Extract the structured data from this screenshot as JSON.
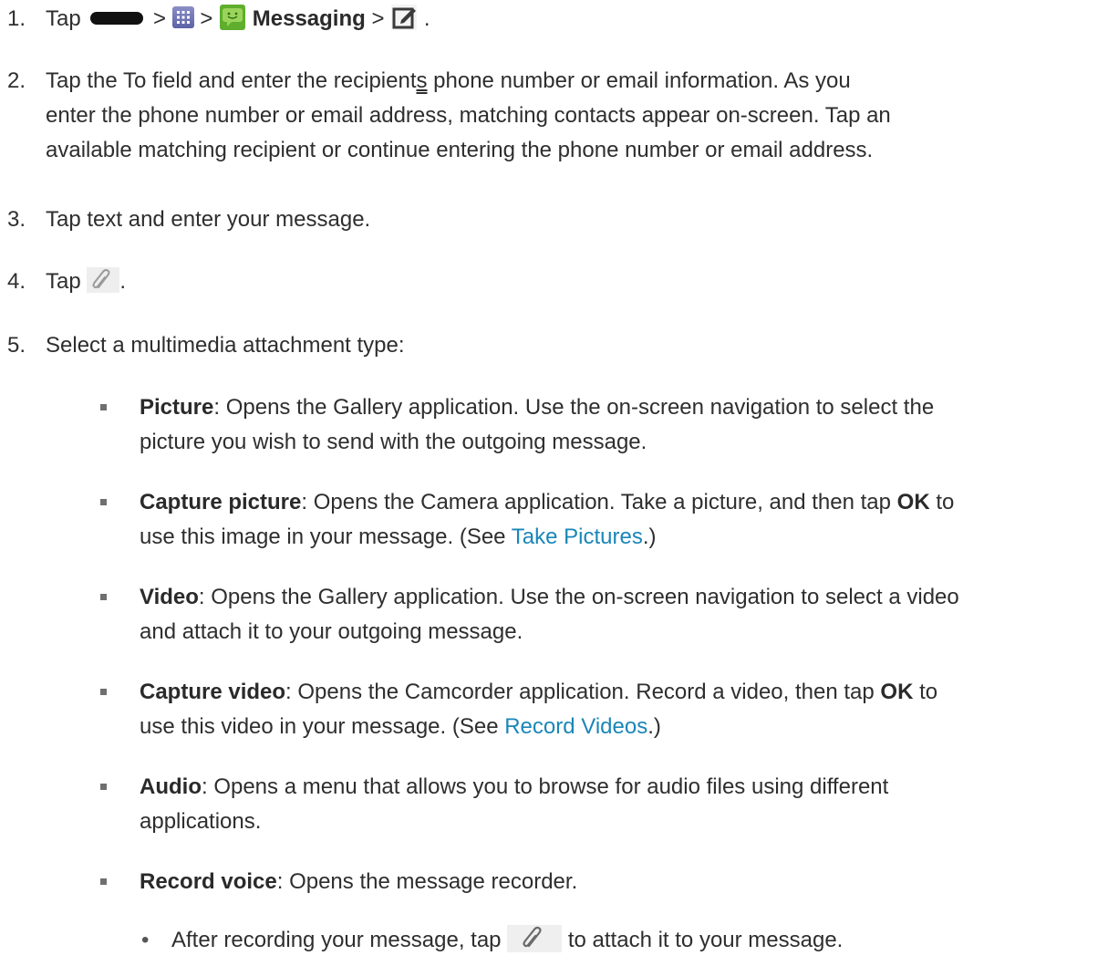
{
  "steps": {
    "s1": {
      "num": "1.",
      "tap": "Tap",
      "sep1": ">",
      "sep2": ">",
      "messaging": "Messaging",
      "sep3": ">",
      "end": ".",
      "icons": [
        "home-key-icon",
        "apps-grid-icon",
        "messaging-app-icon",
        "compose-icon"
      ]
    },
    "s2": {
      "num": "2.",
      "line1a": "Tap the To field and enter the recipient",
      "line1s": "s",
      "line1b": " phone number or email information. As you",
      "line2": "enter the phone number or email address, matching contacts appear on-screen. Tap an",
      "line3": "available matching recipient or continue entering the phone number or email address."
    },
    "s3": {
      "num": "3.",
      "text": "Tap text and enter your message."
    },
    "s4": {
      "num": "4.",
      "tap": "Tap",
      "end": ".",
      "icon": "paperclip-icon"
    },
    "s5": {
      "num": "5.",
      "text": "Select a multimedia attachment type:"
    }
  },
  "bullets": {
    "picture": {
      "term": "Picture",
      "line1": ": Opens the Gallery application. Use the on-screen navigation to select the",
      "line2": "picture you wish to send with the outgoing message."
    },
    "capture_picture": {
      "term": "Capture picture",
      "line1a": ": Opens the Camera application. Take a picture, and then tap ",
      "ok": "OK",
      "line1b": " to",
      "line2a": "use this image in your message. (See ",
      "link": "Take Pictures",
      "line2b": ".)"
    },
    "video": {
      "term": "Video",
      "line1": ": Opens the Gallery application. Use the on-screen navigation to select a video",
      "line2": "and attach it to your outgoing message."
    },
    "capture_video": {
      "term": "Capture video",
      "line1a": ": Opens the Camcorder application. Record a video, then tap ",
      "ok": "OK",
      "line1b": " to",
      "line2a": "use this video in your message. (See ",
      "link": "Record Videos",
      "line2b": ".)"
    },
    "audio": {
      "term": "Audio",
      "line1": ": Opens a menu that allows you to browse for audio files using different",
      "line2": "applications."
    },
    "record_voice": {
      "term": "Record voice",
      "line1": ": Opens the message recorder."
    }
  },
  "sub_bullets": {
    "after_recording": {
      "dot": "•",
      "before": "After recording your message, tap",
      "after": "to attach it to your message.",
      "icon": "paperclip-icon"
    }
  },
  "colors": {
    "text": "#2e2e2e",
    "link": "#1a86b8",
    "bullet": "#6f6f6f"
  }
}
